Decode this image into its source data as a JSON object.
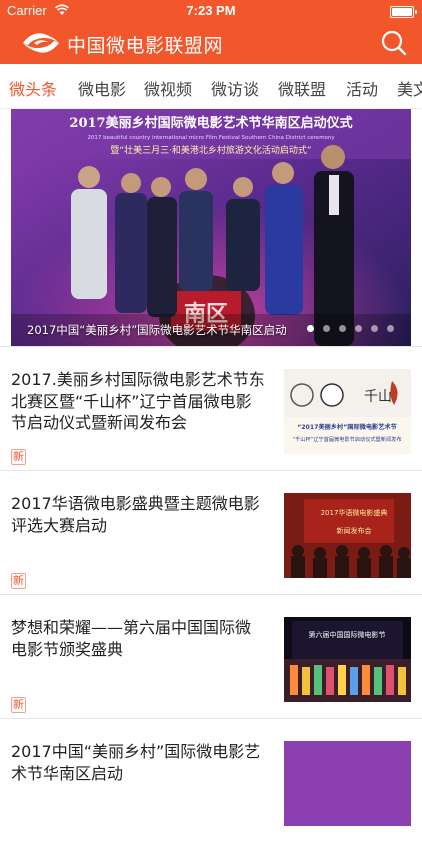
{
  "status_bar": {
    "carrier": "Carrier",
    "time": "7:23 PM",
    "battery_level": 1.0
  },
  "header": {
    "title": "中国微电影联盟网",
    "logo_icon": "swirl-logo-icon",
    "search_icon": "search-icon"
  },
  "tabs": [
    {
      "label": "微头条",
      "active": true
    },
    {
      "label": "微电影",
      "active": false
    },
    {
      "label": "微视频",
      "active": false
    },
    {
      "label": "微访谈",
      "active": false
    },
    {
      "label": "微联盟",
      "active": false
    },
    {
      "label": "活动",
      "active": false
    },
    {
      "label": "美文",
      "active": false
    }
  ],
  "banner": {
    "caption": "2017中国“美丽乡村”国际微电影艺术节华南区启动",
    "image_text": {
      "top": "2017美丽乡村国际微电影艺术节华南区启动仪式",
      "sub": "2017 beautiful country international micro Film Festival Southern China District ceremony",
      "line2": "暨“壮美三月三·和美港北乡村旅游文化活动启动式”",
      "sign": "南区"
    },
    "slide_count": 6,
    "active_slide": 1
  },
  "news": [
    {
      "title": "2017.美丽乡村国际微电影艺术节东北赛区暨“千山杯”辽宁首届微电影节启动仪式暨新闻发布会",
      "badge": "新",
      "thumb": {
        "line1": "“2017美丽乡村”国际微电影艺术节",
        "line2": "“千山杯”辽宁首届微电影节启动仪式暨新闻发布"
      }
    },
    {
      "title": "2017华语微电影盛典暨主题微电影评选大赛启动",
      "badge": "新",
      "thumb": {
        "line1": "2017华语微电影盛典",
        "line2": "新闻发布会"
      }
    },
    {
      "title": "梦想和荣耀——第六届中国国际微电影节颁奖盛典",
      "badge": "新",
      "thumb": {
        "line1": "第六届中国国际微电影节"
      }
    },
    {
      "title": "2017中国“美丽乡村”国际微电影艺术节华南区启动",
      "badge": "",
      "thumb": {
        "line1": ""
      }
    }
  ],
  "colors": {
    "brand": "#f2562b",
    "text": "#222222",
    "divider": "#e6e6e6"
  }
}
